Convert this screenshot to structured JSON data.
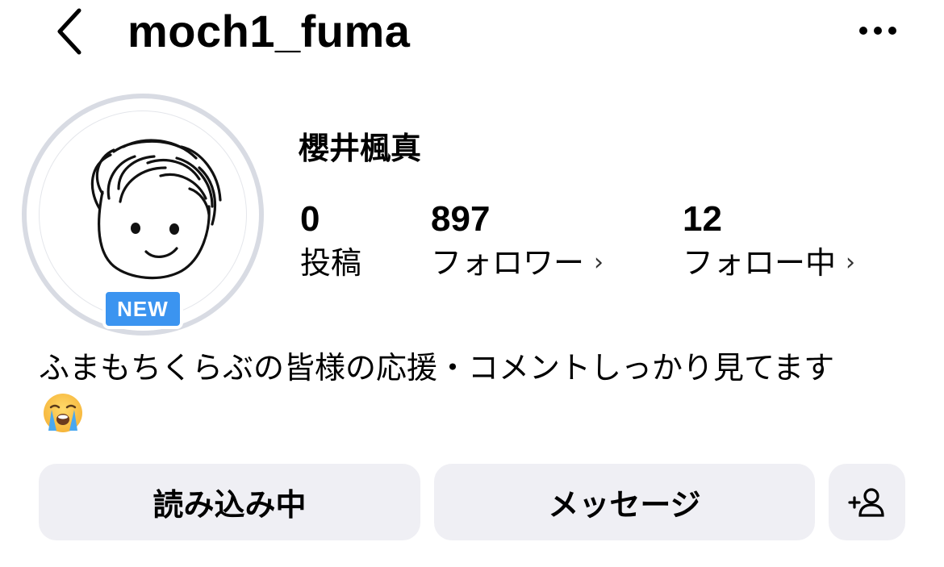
{
  "header": {
    "username": "moch1_fuma",
    "back_icon": "chevron-left-icon",
    "more_icon": "more-dots-icon"
  },
  "profile": {
    "display_name": "櫻井楓真",
    "avatar_badge": "NEW",
    "stats": [
      {
        "count": "0",
        "label": "投稿",
        "has_chevron": false
      },
      {
        "count": "897",
        "label": "フォロワー",
        "has_chevron": true
      },
      {
        "count": "12",
        "label": "フォロー中",
        "has_chevron": true
      }
    ],
    "bio": "ふまもちくらぶの皆様の応援・コメントしっかり見てます",
    "bio_emoji": "loudly-crying-face"
  },
  "actions": {
    "follow_button": "読み込み中",
    "message_button": "メッセージ",
    "add_person_icon": "add-person-icon"
  },
  "colors": {
    "badge": "#3b94f0",
    "button_bg": "#efeff4",
    "ring": "#d8dbe3"
  }
}
